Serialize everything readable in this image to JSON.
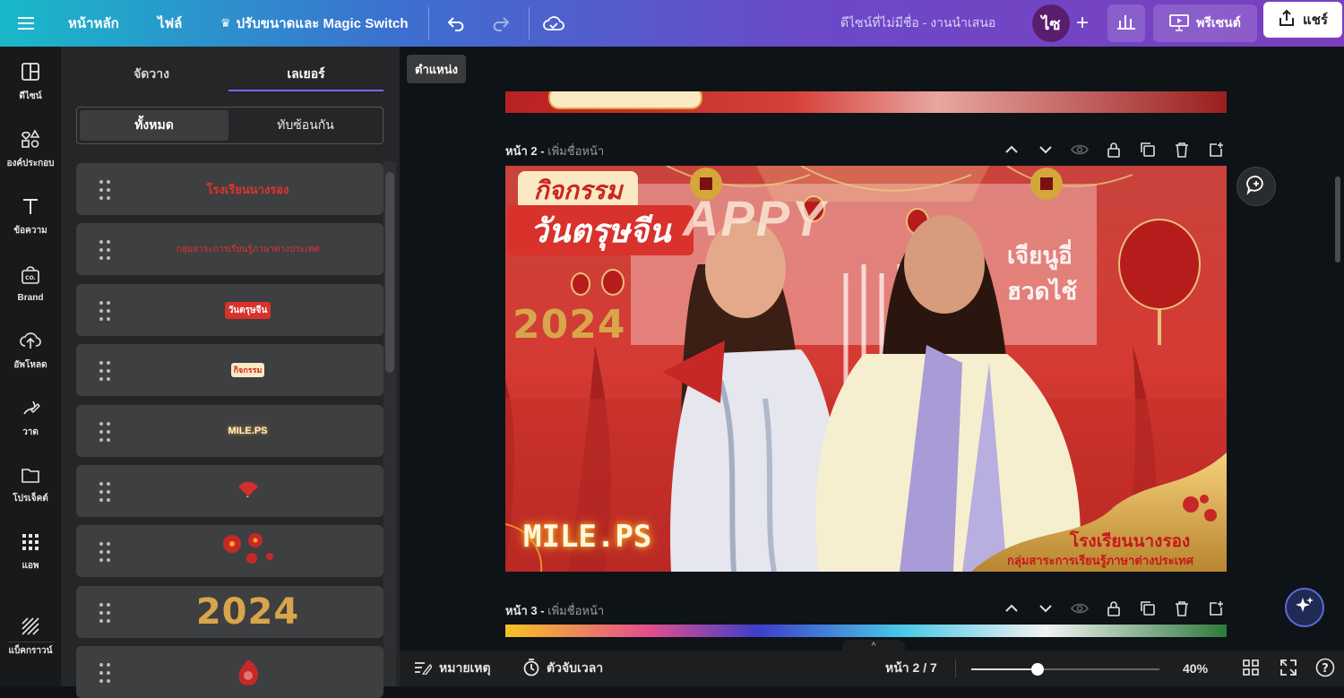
{
  "topbar": {
    "home": "หน้าหลัก",
    "file": "ไฟล์",
    "resize": "ปรับขนาดและ Magic Switch",
    "doc_title": "ดีไซน์ที่ไม่มีชื่อ - งานนำเสนอ",
    "avatar": "ไซ",
    "present": "พรีเซนต์",
    "share": "แชร์"
  },
  "rail": [
    {
      "label": "ดีไซน์",
      "icon": "design-icon"
    },
    {
      "label": "องค์ประกอบ",
      "icon": "elements-icon"
    },
    {
      "label": "ข้อความ",
      "icon": "text-icon"
    },
    {
      "label": "Brand",
      "icon": "brand-icon"
    },
    {
      "label": "อัพโหลด",
      "icon": "upload-icon"
    },
    {
      "label": "วาด",
      "icon": "draw-icon"
    },
    {
      "label": "โปรเจ็คต์",
      "icon": "folder-icon"
    },
    {
      "label": "แอพ",
      "icon": "apps-icon"
    },
    {
      "label": "แบ็คกราวน์",
      "icon": "background-icon"
    }
  ],
  "panel": {
    "tab_arrange": "จัดวาง",
    "tab_layers": "เลเยอร์",
    "seg_all": "ทั้งหมด",
    "seg_overlap": "ทับซ้อนกัน",
    "layers": [
      {
        "text": "โรงเรียนนางรอง",
        "kind": "text-red"
      },
      {
        "text": "กลุ่มสาระการเรียนรู้ภาษาต่างประเทศ",
        "kind": "text-red-small"
      },
      {
        "text": "วันตรุษจีน",
        "kind": "badge-red"
      },
      {
        "text": "กิจกรรม",
        "kind": "badge-cream"
      },
      {
        "text": "MILE.PS",
        "kind": "neon"
      },
      {
        "text": "",
        "kind": "fan"
      },
      {
        "text": "",
        "kind": "flowers"
      },
      {
        "text": "2024",
        "kind": "gold"
      },
      {
        "text": "",
        "kind": "ornament"
      }
    ]
  },
  "canvas": {
    "position": "ตำแหน่ง",
    "page2_label": "หน้า 2 -",
    "page3_label": "หน้า 3 -",
    "add_page_name": "เพิ่มชื่อหน้า",
    "slide": {
      "badge1": "กิจกรรม",
      "badge2": "วันตรุษจีน",
      "year": "2024",
      "brand": "MILE.PS",
      "school": "โรงเรียนนางรอง",
      "dept": "กลุ่มสาระการเรียนรู้ภาษาต่างประเทศ",
      "happy": "APPY",
      "sign1": "เจียนูอี่",
      "sign2": "ฮวดไช้"
    }
  },
  "bottombar": {
    "notes": "หมายเหตุ",
    "timer": "ตัวจับเวลา",
    "page_counter": "หน้า 2 / 7",
    "zoom": "40%",
    "zoom_level": 0.35
  }
}
